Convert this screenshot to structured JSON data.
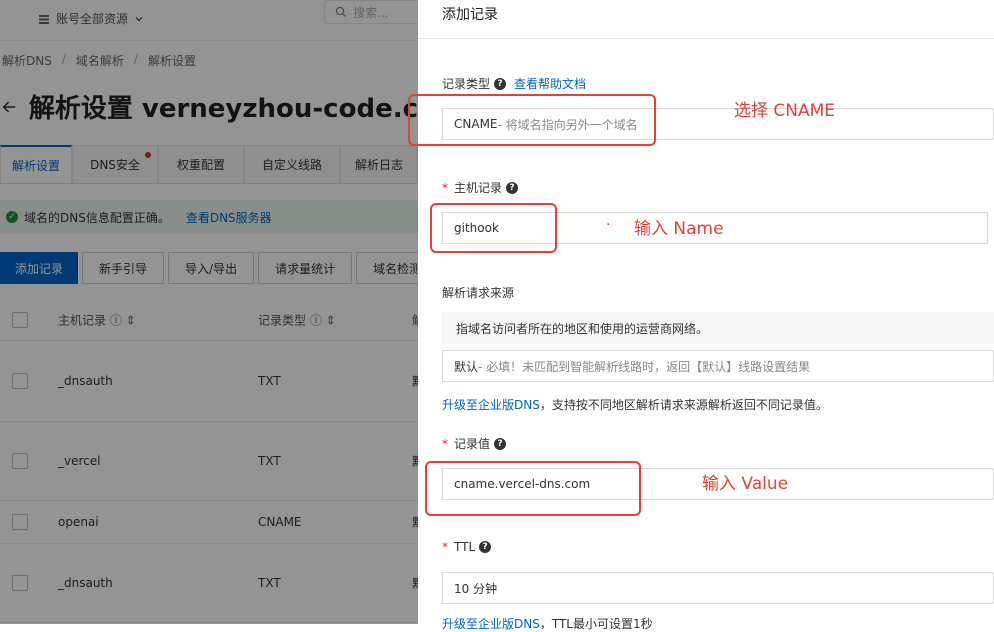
{
  "background": {
    "resource_selector": "账号全部资源",
    "search_placeholder": "搜索...",
    "breadcrumb": [
      "解析DNS",
      "域名解析",
      "解析设置"
    ],
    "page_title": "解析设置 verneyzhou-code.c",
    "tabs": [
      "解析设置",
      "DNS安全",
      "权重配置",
      "自定义线路",
      "解析日志"
    ],
    "notice_text": "域名的DNS信息配置正确。",
    "notice_link": "查看DNS服务器",
    "toolbar": [
      "添加记录",
      "新手引导",
      "导入/导出",
      "请求量统计",
      "域名检测"
    ],
    "table_headers": {
      "host": "主机记录",
      "type": "记录类型",
      "extra": "解"
    },
    "rows": [
      {
        "host": "_dnsauth",
        "type": "TXT",
        "extra": "默"
      },
      {
        "host": "_vercel",
        "type": "TXT",
        "extra": "默"
      },
      {
        "host": "openai",
        "type": "CNAME",
        "extra": "默"
      },
      {
        "host": "_dnsauth",
        "type": "TXT",
        "extra": "默"
      }
    ]
  },
  "drawer": {
    "title": "添加记录",
    "record_type": {
      "label": "记录类型",
      "help_link": "查看帮助文档",
      "value": "CNAME",
      "desc": "- 将域名指向另外一个域名"
    },
    "host": {
      "required": "*",
      "label": "主机记录",
      "value": "githook"
    },
    "source": {
      "label": "解析请求来源",
      "info": "指域名访问者所在的地区和使用的运营商网络。",
      "value": "默认",
      "desc": "- 必填！未匹配到智能解析线路时，返回【默认】线路设置结果",
      "upgrade_link": "升级至企业版DNS",
      "upgrade_text": "，支持按不同地区解析请求来源解析返回不同记录值。"
    },
    "record_value": {
      "required": "*",
      "label": "记录值",
      "value": "cname.vercel-dns.com"
    },
    "ttl": {
      "required": "*",
      "label": "TTL",
      "value": "10 分钟",
      "upgrade_link": "升级至企业版DNS",
      "upgrade_text": "，TTL最小可设置1秒"
    }
  },
  "annotations": {
    "cname": "选择 CNAME",
    "name": "输入 Name",
    "value": "输入 Value"
  },
  "colors": {
    "accent": "#0064c8",
    "annotation": "#e34234"
  }
}
